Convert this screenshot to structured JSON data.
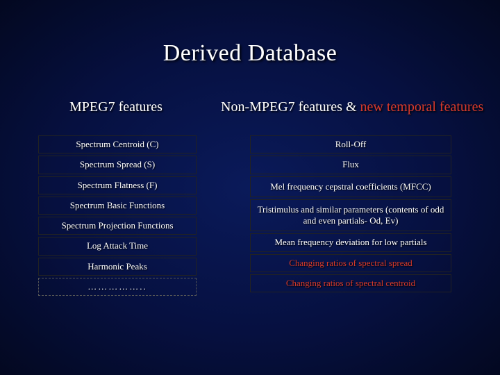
{
  "title": "Derived Database",
  "left": {
    "heading": "MPEG7 features",
    "items": [
      "Spectrum Centroid   (C)",
      "Spectrum Spread   (S)",
      "Spectrum Flatness   (F)",
      "Spectrum Basic Functions",
      "Spectrum Projection Functions",
      "Log Attack Time",
      "Harmonic Peaks"
    ],
    "ellipsis": "…………….."
  },
  "right": {
    "heading_plain": "Non-MPEG7 features & ",
    "heading_red": "new temporal features",
    "items_plain": [
      "Roll-Off",
      "Flux",
      "Mel frequency cepstral coefficients (MFCC)",
      "Tristimulus and similar parameters (contents of odd and even partials- Od, Ev)",
      "Mean frequency deviation for low partials"
    ],
    "items_red": [
      "Changing ratios of spectral spread",
      "Changing  ratios of spectral centroid"
    ]
  }
}
